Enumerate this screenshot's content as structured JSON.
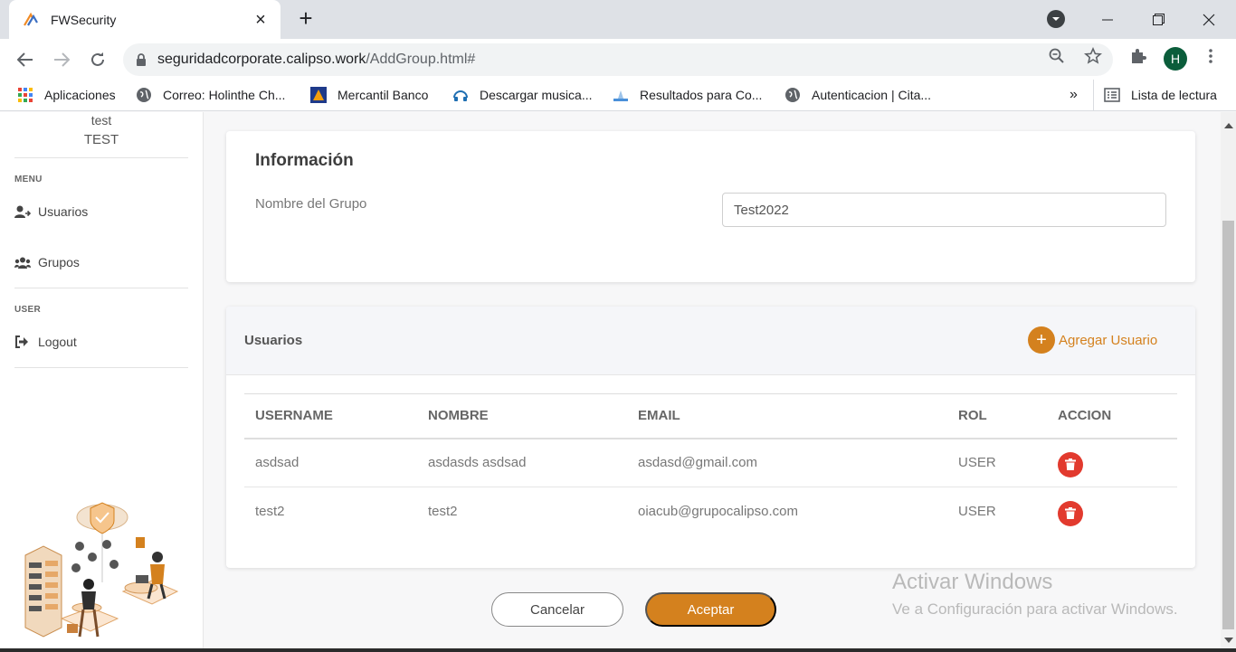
{
  "browser": {
    "tab_title": "FWSecurity",
    "new_tab_label": "+",
    "url_domain": "seguridadcorporate.calipso.work",
    "url_path": "/AddGroup.html#",
    "profile_initial": "H"
  },
  "bookmarks": {
    "items": [
      {
        "label": "Aplicaciones",
        "icon": "apps-grid-icon"
      },
      {
        "label": "Correo: Holinthe Ch...",
        "icon": "globe-icon"
      },
      {
        "label": "Mercantil Banco",
        "icon": "bank-icon"
      },
      {
        "label": "Descargar musica...",
        "icon": "music-icon"
      },
      {
        "label": "Resultados para Co...",
        "icon": "search-result-icon"
      },
      {
        "label": "Autenticacion | Cita...",
        "icon": "globe-icon"
      }
    ],
    "overflow": "»",
    "reading_list": "Lista de lectura"
  },
  "sidebar": {
    "user_line1": "test",
    "user_line2": "TEST",
    "menu_section": "MENU",
    "user_section": "USER",
    "items": [
      {
        "label": "Usuarios",
        "icon": "user-icon"
      },
      {
        "label": "Grupos",
        "icon": "users-group-icon"
      },
      {
        "label": "Logout",
        "icon": "logout-icon"
      }
    ]
  },
  "info": {
    "title": "Información",
    "group_name_label": "Nombre del Grupo",
    "group_name_value": "Test2022"
  },
  "users": {
    "title": "Usuarios",
    "add_label": "Agregar Usuario",
    "columns": [
      "USERNAME",
      "NOMBRE",
      "EMAIL",
      "ROL",
      "ACCION"
    ],
    "rows": [
      {
        "username": "asdsad",
        "nombre": "asdasds asdsad",
        "email": "asdasd@gmail.com",
        "rol": "USER"
      },
      {
        "username": "test2",
        "nombre": "test2",
        "email": "oiacub@grupocalipso.com",
        "rol": "USER"
      }
    ]
  },
  "actions": {
    "cancel": "Cancelar",
    "accept": "Aceptar"
  },
  "watermark": {
    "title": "Activar Windows",
    "subtitle": "Ve a Configuración para activar Windows."
  },
  "colors": {
    "accent": "#d4811e",
    "danger": "#e23a2e",
    "avatar": "#0b5d3b"
  }
}
